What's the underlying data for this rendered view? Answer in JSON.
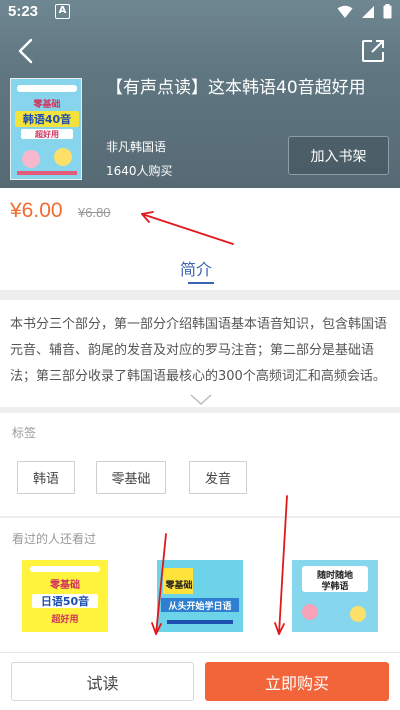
{
  "status_bar": {
    "time": "5:23",
    "notification_badge": "A"
  },
  "book": {
    "title": "【有声点读】这本韩语40音超好用",
    "publisher": "非凡韩国语",
    "buyers": "1640人购买",
    "add_to_shelf_label": "加入书架",
    "price": "¥6.00",
    "original_price": "¥6.80",
    "cover_lines": [
      "零基础",
      "韩语40音",
      "超好用"
    ]
  },
  "tabs": {
    "intro_label": "简介"
  },
  "intro": {
    "text": "本书分三个部分，第一部分介绍韩国语基本语音知识，包含韩国语元音、辅音、韵尾的发音及对应的罗马注音；第二部分是基础语法；第三部分收录了韩国语最核心的300个高频词汇和高频会话。该书外型..."
  },
  "tags_section": {
    "label": "标签",
    "tags": [
      "韩语",
      "零基础",
      "发音"
    ]
  },
  "related_section": {
    "label": "看过的人还看过",
    "books": [
      {
        "lines": [
          "零基础",
          "日语50音",
          "超好用"
        ]
      },
      {
        "lines": [
          "零基础",
          "从头开始学日语"
        ]
      },
      {
        "lines": [
          "随时随地",
          "学韩语"
        ]
      }
    ]
  },
  "actions": {
    "trial_label": "试读",
    "buy_label": "立即购买"
  },
  "colors": {
    "accent_orange": "#f26b2f",
    "tab_blue": "#3b63b5",
    "buy_button": "#f2643a",
    "annotation_red": "#e0191b"
  }
}
